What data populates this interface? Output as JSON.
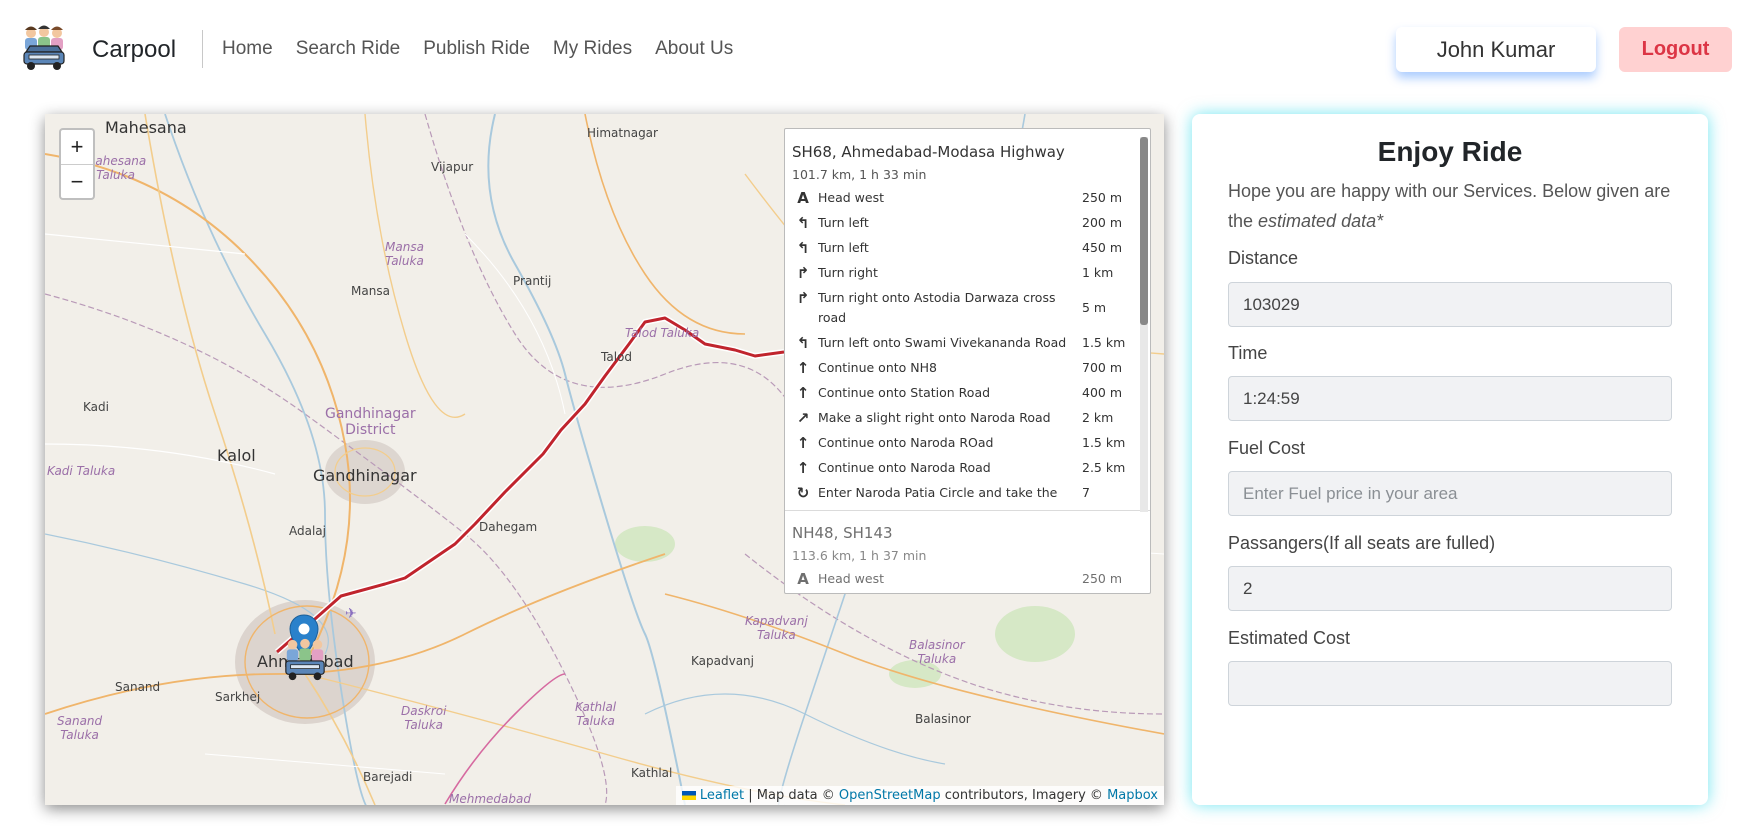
{
  "navbar": {
    "brand": "Carpool",
    "links": [
      "Home",
      "Search Ride",
      "Publish Ride",
      "My Rides",
      "About Us"
    ],
    "user_name": "John Kumar",
    "logout_label": "Logout"
  },
  "map": {
    "zoom_in": "+",
    "zoom_out": "−",
    "places": {
      "mahesana": "Mahesana",
      "mahesana_taluka": "Mahesana\nTaluka",
      "himatnagar": "Himatnagar",
      "vijapur": "Vijapur",
      "mansa_taluka": "Mansa\nTaluka",
      "mansa": "Mansa",
      "prantij": "Prantij",
      "talod_taluka": "Talod Taluka",
      "talod": "Talod",
      "kadi": "Kadi",
      "gandhinagar_district": "Gandhinagar\nDistrict",
      "kalol": "Kalol",
      "gandhinagar": "Gandhinagar",
      "kadi_taluka": "Kadi Taluka",
      "adalaj": "Adalaj",
      "dahegam": "Dahegam",
      "ahmedabad": "Ahmedabad",
      "sanand": "Sanand",
      "sarkhej": "Sarkhej",
      "sanand_taluka": "Sanand\nTaluka",
      "daskroi_taluka": "Daskroi\nTaluka",
      "barejadi": "Barejadi",
      "mehmedabad": "Mehmedabad",
      "kapadvanj_taluka": "Kapadvanj\nTaluka",
      "kapadvanj": "Kapadvanj",
      "balasinor_taluka": "Balasinor\nTaluka",
      "balasinor": "Balasinor",
      "kathlal_taluka": "Kathlal\nTaluka",
      "kathlal": "Kathlal"
    },
    "attribution": {
      "leaflet": "Leaflet",
      "sep1": " | Map data © ",
      "osm": "OpenStreetMap",
      "mid": " contributors, Imagery © ",
      "mapbox": "Mapbox"
    },
    "routes": [
      {
        "name": "SH68, Ahmedabad-Modasa Highway",
        "summary": "101.7 km, 1 h 33 min",
        "instructions": [
          {
            "icon": "A",
            "text": "Head west",
            "dist": "250 m"
          },
          {
            "icon": "↰",
            "text": "Turn left",
            "dist": "200 m"
          },
          {
            "icon": "↰",
            "text": "Turn left",
            "dist": "450 m"
          },
          {
            "icon": "↱",
            "text": "Turn right",
            "dist": "1 km"
          },
          {
            "icon": "↱",
            "text": "Turn right onto Astodia Darwaza cross road",
            "dist": "5 m"
          },
          {
            "icon": "↰",
            "text": "Turn left onto Swami Vivekananda Road",
            "dist": "1.5 km"
          },
          {
            "icon": "↑",
            "text": "Continue onto NH8",
            "dist": "700 m"
          },
          {
            "icon": "↑",
            "text": "Continue onto Station Road",
            "dist": "400 m"
          },
          {
            "icon": "↗",
            "text": "Make a slight right onto Naroda Road",
            "dist": "2 km"
          },
          {
            "icon": "↑",
            "text": "Continue onto Naroda ROad",
            "dist": "1.5 km"
          },
          {
            "icon": "↑",
            "text": "Continue onto Naroda Road",
            "dist": "2.5 km"
          },
          {
            "icon": "↻",
            "text": "Enter Naroda Patia Circle and take the",
            "dist": "7"
          }
        ]
      },
      {
        "name": "NH48, SH143",
        "summary": "113.6 km, 1 h 37 min",
        "instructions": [
          {
            "icon": "A",
            "text": "Head west",
            "dist": "250 m"
          }
        ]
      }
    ]
  },
  "panel": {
    "title": "Enjoy Ride",
    "desc_main": "Hope you are happy with our Services. Below given are the ",
    "desc_em": "estimated data*",
    "fields": {
      "distance": {
        "label": "Distance",
        "value": "103029"
      },
      "time": {
        "label": "Time",
        "value": "1:24:59"
      },
      "fuel": {
        "label": "Fuel Cost",
        "placeholder": "Enter Fuel price in your area"
      },
      "passengers": {
        "label": "Passangers(If all seats are fulled)",
        "value": "2"
      },
      "estimated": {
        "label": "Estimated Cost",
        "value": ""
      }
    }
  }
}
